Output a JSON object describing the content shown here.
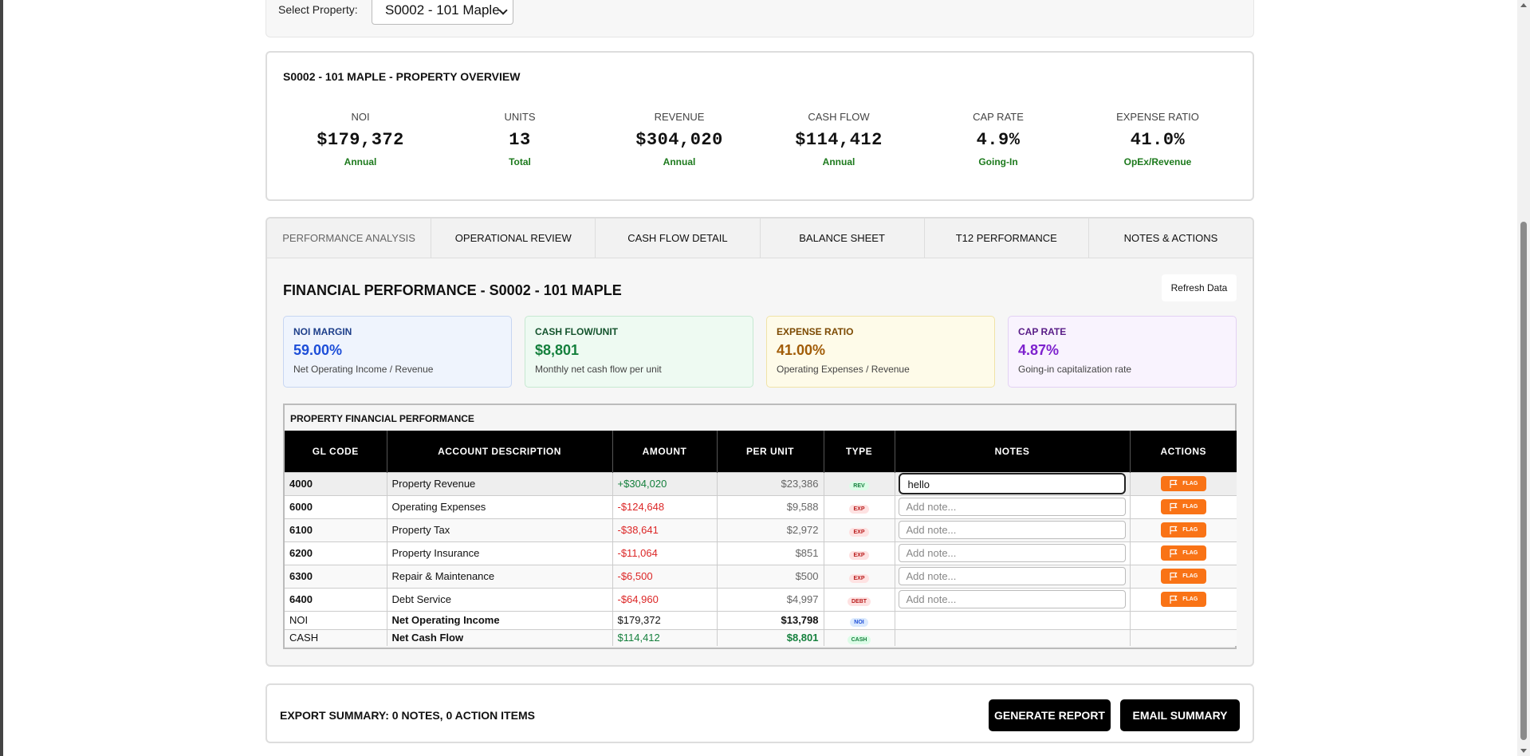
{
  "selector": {
    "label": "Select Property:",
    "selected": "S0002 - 101 Maple"
  },
  "overview": {
    "title": "S0002 - 101 MAPLE - PROPERTY OVERVIEW",
    "metrics": [
      {
        "label": "NOI",
        "value": "$179,372",
        "sub": "Annual"
      },
      {
        "label": "UNITS",
        "value": "13",
        "sub": "Total"
      },
      {
        "label": "REVENUE",
        "value": "$304,020",
        "sub": "Annual"
      },
      {
        "label": "CASH FLOW",
        "value": "$114,412",
        "sub": "Annual"
      },
      {
        "label": "CAP RATE",
        "value": "4.9%",
        "sub": "Going-In"
      },
      {
        "label": "EXPENSE RATIO",
        "value": "41.0%",
        "sub": "OpEx/Revenue"
      }
    ]
  },
  "tabs": [
    "PERFORMANCE ANALYSIS",
    "OPERATIONAL REVIEW",
    "CASH FLOW DETAIL",
    "BALANCE SHEET",
    "T12 PERFORMANCE",
    "NOTES & ACTIONS"
  ],
  "panel": {
    "title": "FINANCIAL PERFORMANCE - S0002 - 101 MAPLE",
    "refresh_label": "Refresh Data",
    "kpis": [
      {
        "label": "NOI MARGIN",
        "value": "59.00%",
        "desc": "Net Operating Income / Revenue"
      },
      {
        "label": "CASH FLOW/UNIT",
        "value": "$8,801",
        "desc": "Monthly net cash flow per unit"
      },
      {
        "label": "EXPENSE RATIO",
        "value": "41.00%",
        "desc": "Operating Expenses / Revenue"
      },
      {
        "label": "CAP RATE",
        "value": "4.87%",
        "desc": "Going-in capitalization rate"
      }
    ]
  },
  "table": {
    "title": "PROPERTY FINANCIAL PERFORMANCE",
    "headers": [
      "GL CODE",
      "ACCOUNT DESCRIPTION",
      "AMOUNT",
      "PER UNIT",
      "TYPE",
      "NOTES",
      "ACTIONS"
    ],
    "note_placeholder": "Add note...",
    "flag_label": "FLAG",
    "rows": [
      {
        "code": "4000",
        "desc": "Property Revenue",
        "amount": "+$304,020",
        "per_unit": "$23,386",
        "type": "REV",
        "note": "hello"
      },
      {
        "code": "6000",
        "desc": "Operating Expenses",
        "amount": "-$124,648",
        "per_unit": "$9,588",
        "type": "EXP",
        "note": ""
      },
      {
        "code": "6100",
        "desc": "Property Tax",
        "amount": "-$38,641",
        "per_unit": "$2,972",
        "type": "EXP",
        "note": ""
      },
      {
        "code": "6200",
        "desc": "Property Insurance",
        "amount": "-$11,064",
        "per_unit": "$851",
        "type": "EXP",
        "note": ""
      },
      {
        "code": "6300",
        "desc": "Repair & Maintenance",
        "amount": "-$6,500",
        "per_unit": "$500",
        "type": "EXP",
        "note": ""
      },
      {
        "code": "6400",
        "desc": "Debt Service",
        "amount": "-$64,960",
        "per_unit": "$4,997",
        "type": "DEBT",
        "note": ""
      }
    ],
    "totals": [
      {
        "code": "NOI",
        "desc": "Net Operating Income",
        "amount": "$179,372",
        "per_unit": "$13,798",
        "type": "NOI"
      },
      {
        "code": "CASH",
        "desc": "Net Cash Flow",
        "amount": "$114,412",
        "per_unit": "$8,801",
        "type": "CASH"
      }
    ]
  },
  "export": {
    "title": "EXPORT SUMMARY: 0 NOTES, 0 ACTION ITEMS",
    "generate_label": "GENERATE REPORT",
    "email_label": "EMAIL SUMMARY"
  }
}
